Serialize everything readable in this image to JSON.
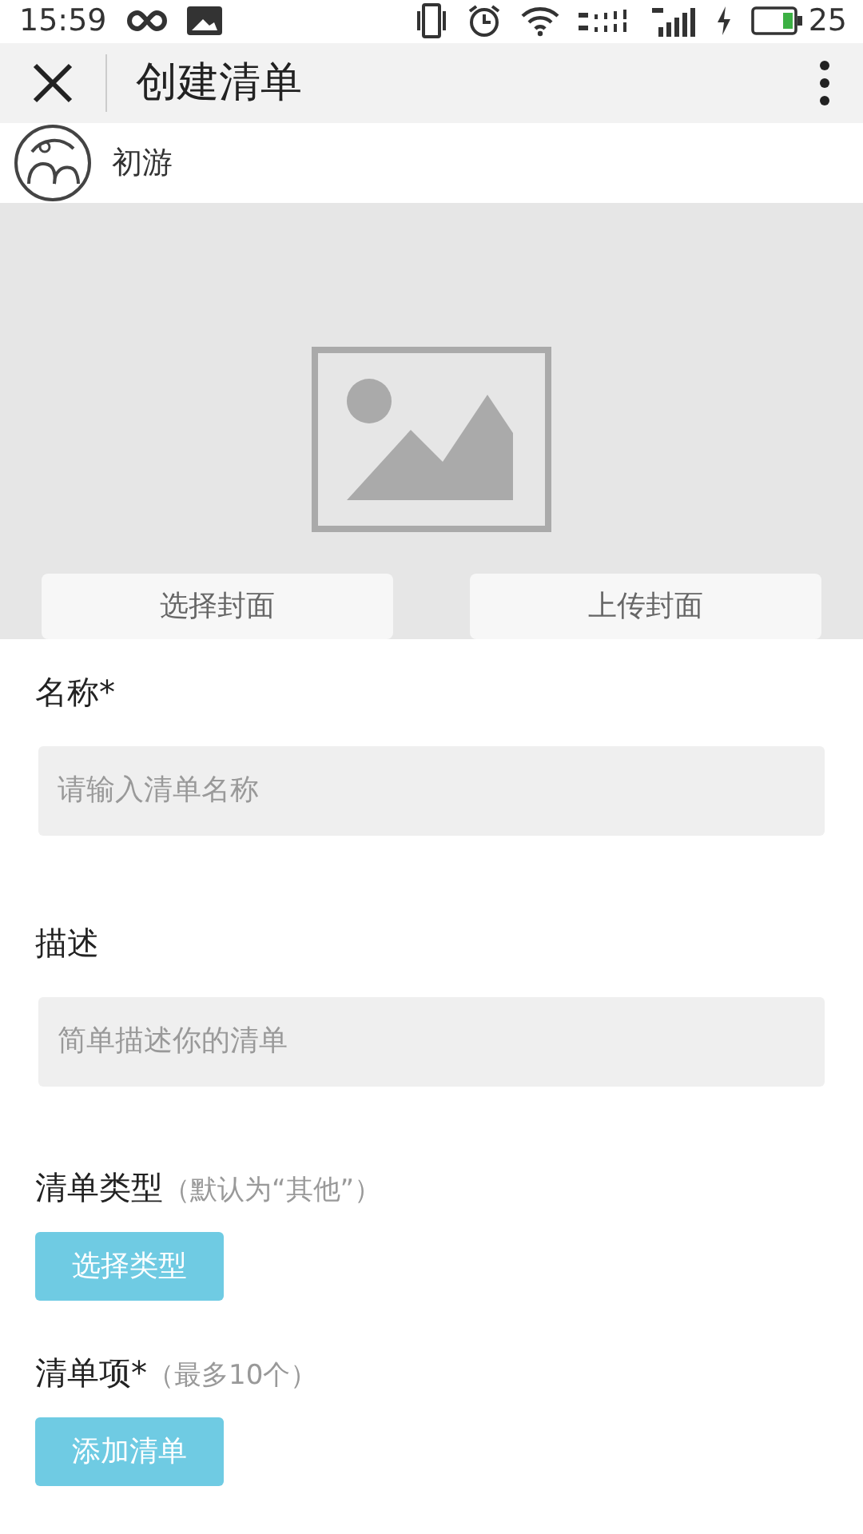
{
  "status_bar": {
    "time": "15:59",
    "battery": "25"
  },
  "header": {
    "title": "创建清单"
  },
  "account": {
    "name": "初游"
  },
  "cover": {
    "buttons": [
      "选择封面",
      "上传封面"
    ]
  },
  "fields": [
    {
      "label": "名称*",
      "placeholder": "请输入清单名称"
    },
    {
      "label": "描述",
      "placeholder": "简单描述你的清单"
    }
  ],
  "sections": [
    {
      "label": "清单类型",
      "hint": "（默认为“其他”）",
      "button": "选择类型"
    },
    {
      "label": "清单项*",
      "hint": "（最多10个）",
      "button": "添加清单"
    }
  ]
}
